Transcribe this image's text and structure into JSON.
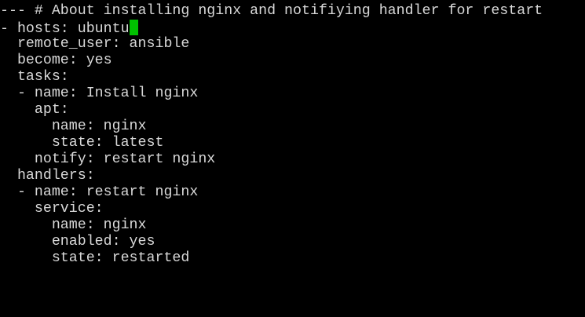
{
  "terminal": {
    "lines": [
      "--- # About installing nginx and notifiying handler for restart",
      "- hosts: ubuntu",
      "  remote_user: ansible",
      "  become: yes",
      "  tasks:",
      "  - name: Install nginx",
      "    apt:",
      "      name: nginx",
      "      state: latest",
      "    notify: restart nginx",
      "  handlers:",
      "  - name: restart nginx",
      "    service:",
      "      name: nginx",
      "      enabled: yes",
      "      state: restarted"
    ],
    "cursor_line": 1,
    "colors": {
      "background": "#000000",
      "text": "#d8d8d8",
      "cursor": "#00c000"
    }
  }
}
